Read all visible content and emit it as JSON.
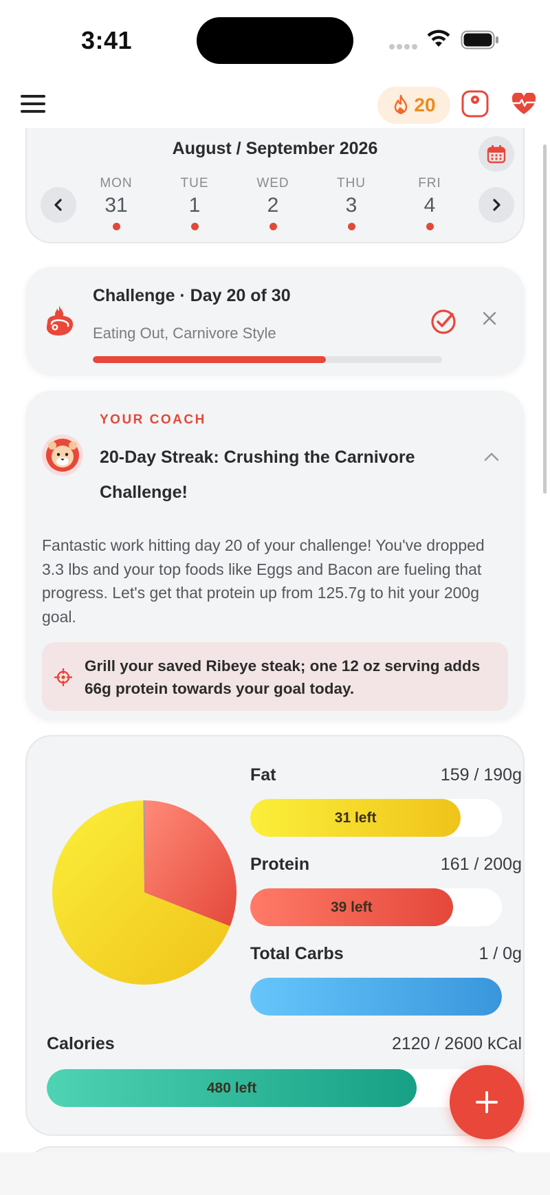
{
  "status_bar": {
    "time": "3:41"
  },
  "header": {
    "streak_count": "20",
    "streak_icon": "flame-icon",
    "scale_icon": "scale-icon",
    "health_icon": "heart-pulse-icon"
  },
  "calendar": {
    "title": "August / September 2026",
    "days": [
      {
        "dow": "MON",
        "num": "31"
      },
      {
        "dow": "TUE",
        "num": "1"
      },
      {
        "dow": "WED",
        "num": "2"
      },
      {
        "dow": "THU",
        "num": "3"
      },
      {
        "dow": "FRI",
        "num": "4"
      }
    ]
  },
  "challenge": {
    "title": "Challenge · Day 20 of 30",
    "subtitle": "Eating Out, Carnivore Style",
    "progress": 0.667
  },
  "coach": {
    "label": "YOUR COACH",
    "title": "20-Day Streak: Crushing the Carnivore Challenge!",
    "body": "Fantastic work hitting day 20 of your challenge! You've dropped 3.3 lbs and your top foods like Eggs and Bacon are fueling that progress. Let's get that protein up from 125.7g to hit your 200g goal.",
    "tip": "Grill your saved Ribeye steak; one 12 oz serving adds 66g protein towards your goal today."
  },
  "macros": {
    "fat": {
      "label": "Fat",
      "value": "159 / 190g",
      "left": "31 left",
      "consumed": 159,
      "goal": 190
    },
    "protein": {
      "label": "Protein",
      "value": "161 / 200g",
      "left": "39 left",
      "consumed": 161,
      "goal": 200
    },
    "carbs": {
      "label": "Total Carbs",
      "value": "1 / 0g",
      "left": "",
      "consumed": 1,
      "goal": 0
    },
    "calories": {
      "label": "Calories",
      "value": "2120 / 2600 kCal",
      "left": "480 left",
      "consumed": 2120,
      "goal": 2600
    }
  },
  "colors": {
    "accent": "#e8473a",
    "fat": "#f7d51f",
    "protein": "#ee5a4a",
    "carbs": "#4aa8ea",
    "calories": "#22b08f"
  }
}
